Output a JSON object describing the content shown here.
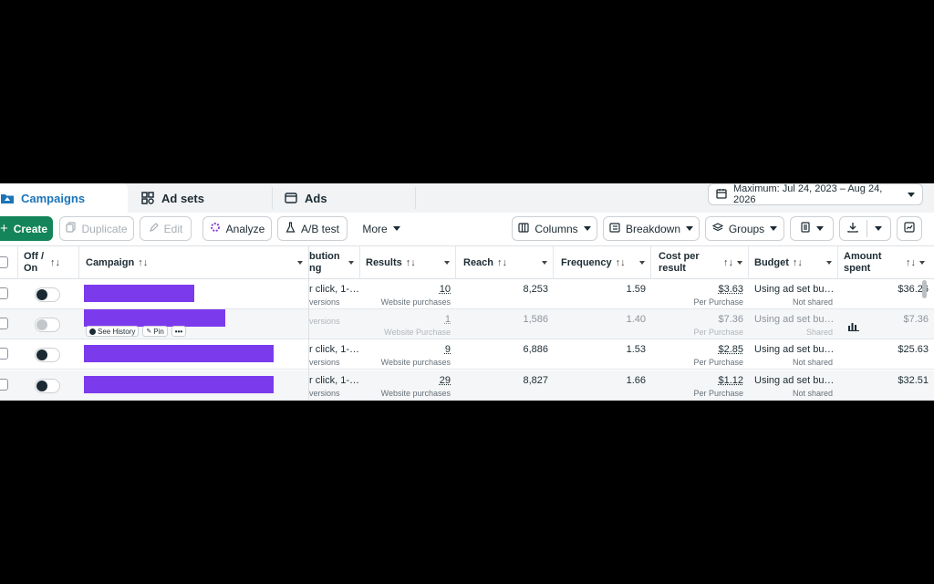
{
  "tabs": [
    {
      "label": "Campaigns",
      "icon": "folder-icon",
      "active": true
    },
    {
      "label": "Ad sets",
      "icon": "grid-icon",
      "active": false
    },
    {
      "label": "Ads",
      "icon": "ad-icon",
      "active": false
    }
  ],
  "date_range": {
    "label": "Maximum: Jul 24, 2023 – Aug 24, 2026"
  },
  "toolbar": {
    "create": "Create",
    "duplicate": "Duplicate",
    "edit": "Edit",
    "analyze": "Analyze",
    "ab_test": "A/B test",
    "more": "More",
    "columns": "Columns",
    "breakdown": "Breakdown",
    "groups": "Groups"
  },
  "columns": {
    "offon": "Off / On",
    "campaign": "Campaign",
    "attribution": "bution\nng",
    "results": "Results",
    "reach": "Reach",
    "frequency": "Frequency",
    "cost_per_result": "Cost per result",
    "budget": "Budget",
    "amount_spent": "Amount spent"
  },
  "hover_actions": {
    "history": "See History",
    "pin": "Pin",
    "more": "•••"
  },
  "rows": [
    {
      "on": true,
      "attribution": "r click, 1-…",
      "attribution_sub": "versions",
      "results": "10",
      "results_sub": "Website purchases",
      "reach": "8,253",
      "frequency": "1.59",
      "cpr": "$3.63",
      "cpr_sub": "Per Purchase",
      "budget": "Using ad set bu…",
      "budget_sub": "Not shared",
      "spent": "$36.26"
    },
    {
      "on": false,
      "attribution": "",
      "attribution_sub": "versions",
      "results": "1",
      "results_sub": "Website Purchase",
      "reach": "1,586",
      "frequency": "1.40",
      "cpr": "$7.36",
      "cpr_sub": "Per Purchase",
      "budget": "Using ad set bu…",
      "budget_sub": "Shared",
      "spent": "$7.36"
    },
    {
      "on": true,
      "attribution": "r click, 1-…",
      "attribution_sub": "versions",
      "results": "9",
      "results_sub": "Website purchases",
      "reach": "6,886",
      "frequency": "1.53",
      "cpr": "$2.85",
      "cpr_sub": "Per Purchase",
      "budget": "Using ad set bu…",
      "budget_sub": "Not shared",
      "spent": "$25.63"
    },
    {
      "on": true,
      "attribution": "r click, 1-…",
      "attribution_sub": "versions",
      "results": "29",
      "results_sub": "Website purchases",
      "reach": "8,827",
      "frequency": "1.66",
      "cpr": "$1.12",
      "cpr_sub": "Per Purchase",
      "budget": "Using ad set bu…",
      "budget_sub": "Not shared",
      "spent": "$32.51"
    }
  ],
  "colors": {
    "accent": "#1b74b8",
    "create": "#14855a",
    "redaction": "#7c3aed"
  }
}
